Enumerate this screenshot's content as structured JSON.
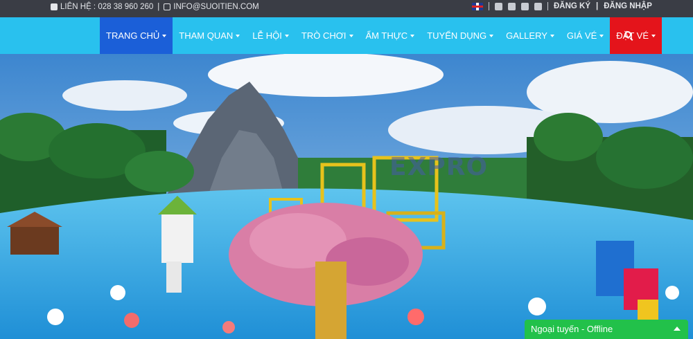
{
  "topbar": {
    "phone_text": "LIÊN HỆ : 028 38 960 260",
    "separator": "|",
    "email_text": "INFO@SUOITIEN.COM",
    "register": "ĐĂNG KÝ",
    "login": "ĐĂNG NHẬP",
    "social_icons": [
      "uk-flag-icon",
      "facebook-icon",
      "flickr-icon",
      "youtube-icon",
      "instagram-icon"
    ]
  },
  "nav": {
    "items": [
      {
        "label": "TRANG CHỦ"
      },
      {
        "label": "THAM QUAN"
      },
      {
        "label": "LỄ HỘI"
      },
      {
        "label": "TRÒ CHƠI"
      },
      {
        "label": "ẨM THỰC"
      },
      {
        "label": "TUYỂN DỤNG"
      },
      {
        "label": "GALLERY"
      },
      {
        "label": "GIÁ VÉ"
      },
      {
        "label": "ĐẶT VÉ"
      }
    ],
    "active_color": "#1b5fd8",
    "ticket_color": "#e4141b",
    "bar_color": "#29c1ee"
  },
  "hero": {
    "watermark": "EXPRO"
  },
  "chat": {
    "label": "Ngoại tuyến - Offline",
    "color": "#22c14a"
  }
}
